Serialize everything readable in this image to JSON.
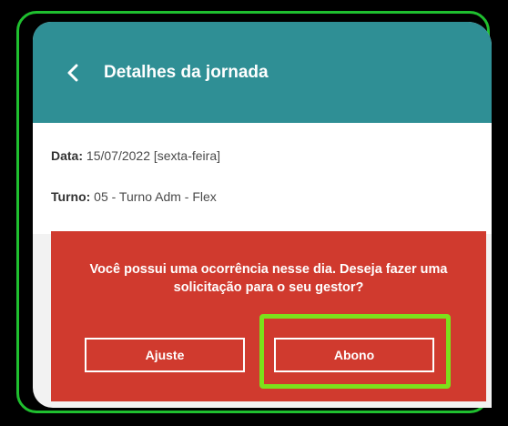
{
  "colors": {
    "header": "#2f8f95",
    "alert": "#d03a2e",
    "highlight": "#7ce11b",
    "frame": "#1fbf2f"
  },
  "header": {
    "back_icon": "chevron-left-icon",
    "title": "Detalhes da jornada"
  },
  "info": {
    "date_label": "Data:",
    "date_value": " 15/07/2022 [sexta-feira]",
    "shift_label": "Turno:",
    "shift_value": " 05 - Turno Adm - Flex"
  },
  "alert": {
    "message": "Você possui uma ocorrência nesse dia. Deseja fazer uma solicitação para o seu gestor?",
    "adjust_label": "Ajuste",
    "abono_label": "Abono"
  }
}
